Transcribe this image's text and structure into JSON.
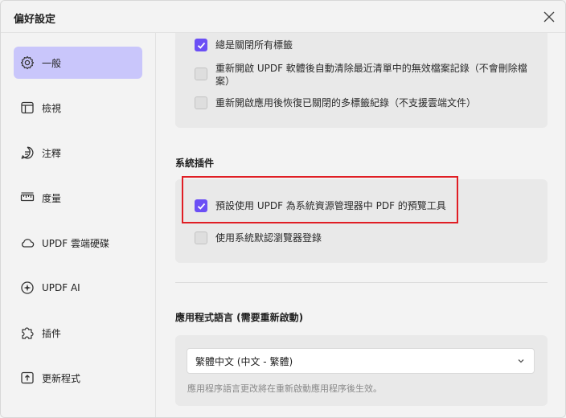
{
  "window": {
    "title": "偏好設定"
  },
  "sidebar": {
    "items": [
      {
        "label": "一般",
        "icon": "gear-icon",
        "active": true
      },
      {
        "label": "檢視",
        "icon": "layout-icon",
        "active": false
      },
      {
        "label": "注釋",
        "icon": "comment-icon",
        "active": false
      },
      {
        "label": "度量",
        "icon": "ruler-icon",
        "active": false
      },
      {
        "label": "UPDF 雲端硬碟",
        "icon": "cloud-icon",
        "active": false
      },
      {
        "label": "UPDF AI",
        "icon": "ai-sparkle-icon",
        "active": false
      },
      {
        "label": "插件",
        "icon": "puzzle-icon",
        "active": false
      },
      {
        "label": "更新程式",
        "icon": "update-icon",
        "active": false
      }
    ]
  },
  "tabs_group": {
    "options": [
      {
        "label": "總是關閉所有標籤",
        "checked": true
      },
      {
        "label": "重新開啟 UPDF 軟體後自動清除最近清單中的無效檔案記錄（不會刪除檔案）",
        "checked": false
      },
      {
        "label": "重新開啟應用後恢復已關閉的多標籤紀錄（不支援雲端文件）",
        "checked": false
      }
    ]
  },
  "system_plugins": {
    "heading": "系統插件",
    "options": [
      {
        "label": "預設使用 UPDF 為系統資源管理器中 PDF 的預覽工具",
        "checked": true
      },
      {
        "label": "使用系統默認瀏覽器登錄",
        "checked": false
      }
    ]
  },
  "language": {
    "heading": "應用程式語言 (需要重新啟動)",
    "selected": "繁體中文 (中文 - 繁體)",
    "hint": "應用程序語言更改將在重新啟動應用程序後生效。"
  },
  "colors": {
    "accent": "#6b4ff5",
    "active_nav_bg": "#c9c6fb",
    "highlight_border": "#e01e24"
  }
}
